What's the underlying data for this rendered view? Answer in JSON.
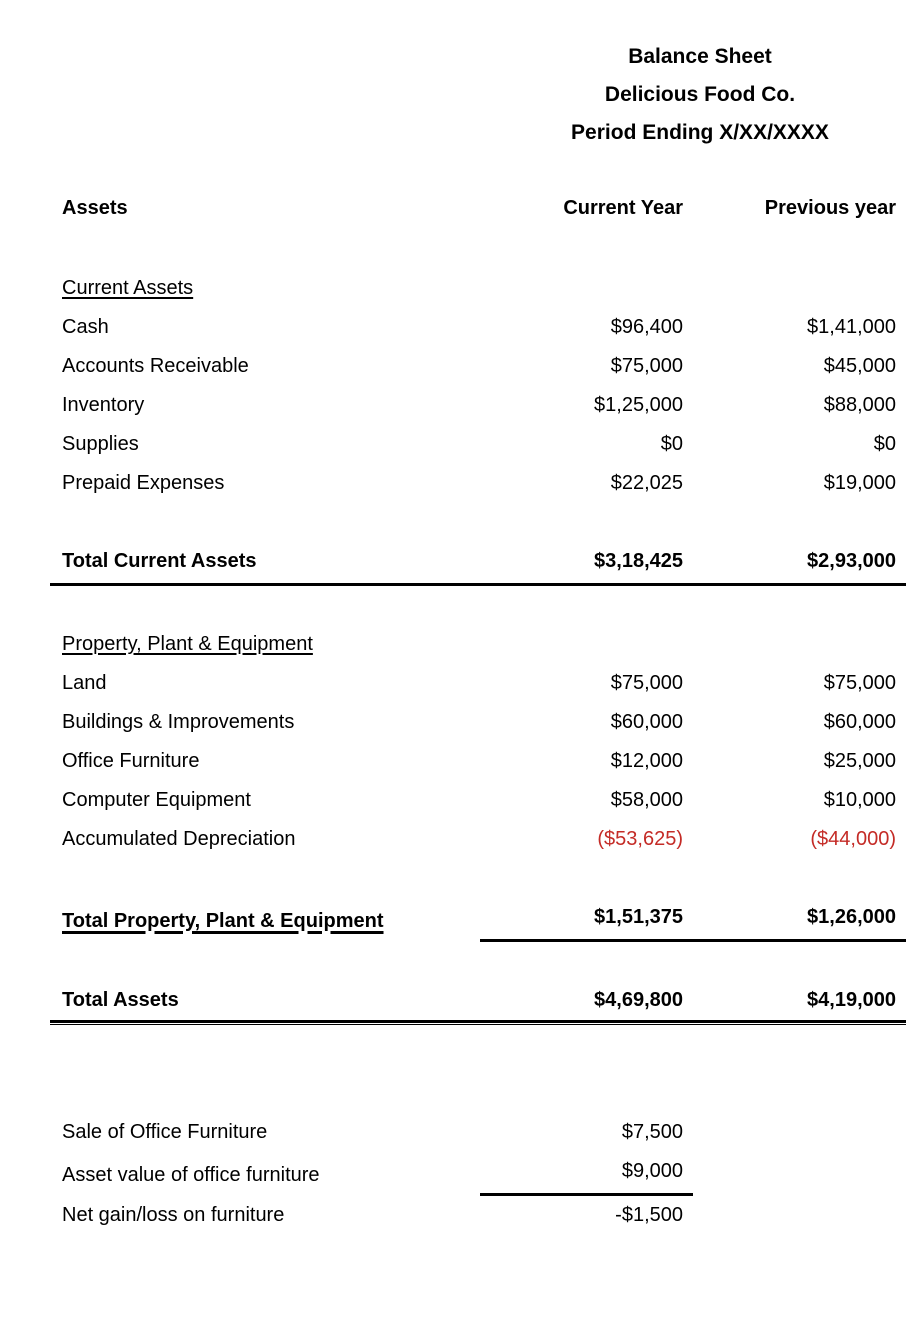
{
  "document": {
    "title_lines": [
      "Balance Sheet",
      "Delicious Food Co.",
      "Period Ending X/XX/XXXX"
    ]
  },
  "columns": {
    "label_header": "Assets",
    "current_year": "Current Year",
    "previous_year": "Previous year"
  },
  "colors": {
    "text": "#000000",
    "negative": "#C42B26",
    "rule": "#000000",
    "background": "#FFFFFF"
  },
  "sections": {
    "current_assets": {
      "heading": "Current Assets",
      "rows": [
        {
          "label": "Cash",
          "current": "$96,400",
          "previous": "$1,41,000"
        },
        {
          "label": "Accounts Receivable",
          "current": "$75,000",
          "previous": "$45,000"
        },
        {
          "label": "Inventory",
          "current": "$1,25,000",
          "previous": "$88,000"
        },
        {
          "label": "Supplies",
          "current": "$0",
          "previous": "$0"
        },
        {
          "label": "Prepaid Expenses",
          "current": "$22,025",
          "previous": "$19,000"
        }
      ],
      "total": {
        "label": "Total Current Assets",
        "current": "$3,18,425",
        "previous": "$2,93,000"
      }
    },
    "ppe": {
      "heading": "Property, Plant & Equipment",
      "rows": [
        {
          "label": "Land",
          "current": "$75,000",
          "previous": "$75,000"
        },
        {
          "label": "Buildings & Improvements",
          "current": "$60,000",
          "previous": "$60,000"
        },
        {
          "label": "Office Furniture",
          "current": "$12,000",
          "previous": "$25,000"
        },
        {
          "label": "Computer Equipment",
          "current": "$58,000",
          "previous": "$10,000"
        },
        {
          "label": "Accumulated Depreciation",
          "current": "($53,625)",
          "previous": "($44,000)"
        }
      ],
      "total": {
        "label": "Total Property, Plant & Equipment",
        "current": "$1,51,375",
        "previous": "$1,26,000"
      }
    },
    "grand_total": {
      "label": "Total Assets",
      "current": "$4,69,800",
      "previous": "$4,19,000"
    },
    "furniture_note": {
      "rows": [
        {
          "label": "Sale of Office Furniture",
          "current": "$7,500",
          "previous": ""
        },
        {
          "label": "Asset value of office furniture",
          "current": "$9,000",
          "previous": ""
        },
        {
          "label": "Net gain/loss on furniture",
          "current": "-$1,500",
          "previous": ""
        }
      ]
    }
  }
}
